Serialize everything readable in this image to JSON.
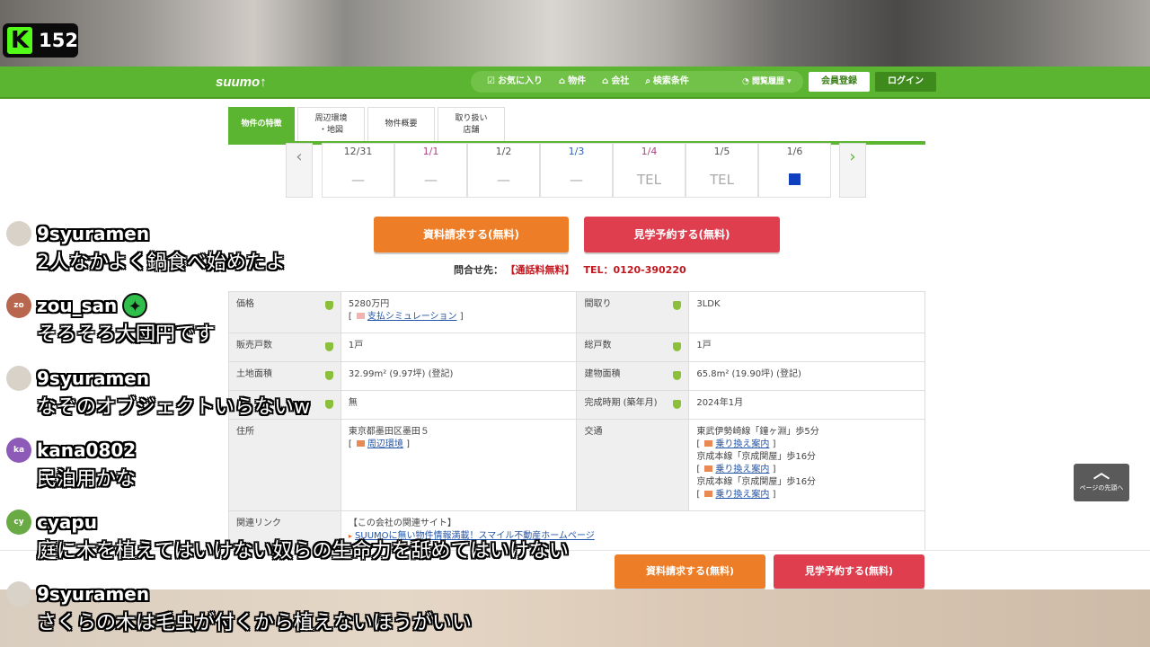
{
  "kick": {
    "logo": "K",
    "viewers": "152"
  },
  "site": {
    "logo": "suumo↑",
    "nav": [
      {
        "icon": "☑",
        "label": "お気に入り"
      },
      {
        "icon": "⌂",
        "label": "物件"
      },
      {
        "icon": "⌂",
        "label": "会社"
      },
      {
        "icon": "⌕",
        "label": "検索条件"
      }
    ],
    "history": "◔ 閲覧履歴 ▾",
    "register": "会員登録",
    "login": "ログイン"
  },
  "tabs": [
    {
      "label": "物件の特徴"
    },
    {
      "label": "周辺環境\n・地図"
    },
    {
      "label": "物件概要"
    },
    {
      "label": "取り扱い\n店舗"
    }
  ],
  "calendar": [
    {
      "date": "12/31",
      "val": "—"
    },
    {
      "date": "1/1",
      "val": "—"
    },
    {
      "date": "1/2",
      "val": "—"
    },
    {
      "date": "1/3",
      "val": "—"
    },
    {
      "date": "1/4",
      "val": "TEL"
    },
    {
      "date": "1/5",
      "val": "TEL"
    },
    {
      "date": "1/6",
      "val": ""
    }
  ],
  "buttons": {
    "request": "資料請求する(無料)",
    "visit": "見学予約する(無料)",
    "request2": "資料請求する(無料)",
    "visit2": "見学予約する(無料)"
  },
  "contact": {
    "label": "問合せ先：",
    "free": "【通話料無料】",
    "tel": "TEL：0120-390220"
  },
  "spec": {
    "price_h": "価格",
    "price": "5280万円",
    "sim": "支払シミュレーション",
    "layout_h": "間取り",
    "layout": "3LDK",
    "units_h": "販売戸数",
    "units": "1戸",
    "total_h": "総戸数",
    "total": "1戸",
    "land_h": "土地面積",
    "land": "32.99m² (9.97坪) (登記)",
    "bldg_h": "建物面積",
    "bldg": "65.8m² (19.90坪) (登記)",
    "r4_v": "無",
    "built_h": "完成時期 (築年月)",
    "built": "2024年1月",
    "addr_h": "住所",
    "addr": "東京都墨田区墨田５",
    "env": "周辺環境",
    "transit_h": "交通",
    "transit": [
      {
        "line": "東武伊勢崎線「鐘ヶ淵」歩5分",
        "link": "乗り換え案内"
      },
      {
        "line": "京成本線「京成関屋」歩16分",
        "link": "乗り換え案内"
      },
      {
        "line": "京成本線「京成関屋」歩16分",
        "link": "乗り換え案内"
      }
    ],
    "rel_h": "関連リンク",
    "rel_title": "【この会社の関連サイト】",
    "rel_link": "SUUMOに無い物件情報満載！スマイル不動産ホームページ"
  },
  "totop": {
    "label": "ページの先頭へ"
  },
  "chat": [
    {
      "user": "9syuramen",
      "text": "2人なかよく鍋食べ始めたよ",
      "avatar": "",
      "color": "#d9d2c8"
    },
    {
      "user": "zou_san",
      "text": "そろそろ大団円です",
      "avatar": "zo",
      "color": "#b9664e",
      "badge": "✦"
    },
    {
      "user": "9syuramen",
      "text": "なぞのオブジェクトいらないw",
      "avatar": "",
      "color": "#d9d2c8"
    },
    {
      "user": "kana0802",
      "text": "民泊用かな",
      "avatar": "ka",
      "color": "#8e5ab8"
    },
    {
      "user": "cyapu",
      "text": "庭に木を植えてはいけない奴らの生命力を舐めてはいけない",
      "avatar": "cy",
      "color": "#6aaa45"
    },
    {
      "user": "9syuramen",
      "text": "さくらの木は毛虫が付くから植えないほうがいい",
      "avatar": "",
      "color": "#d9d2c8"
    }
  ]
}
